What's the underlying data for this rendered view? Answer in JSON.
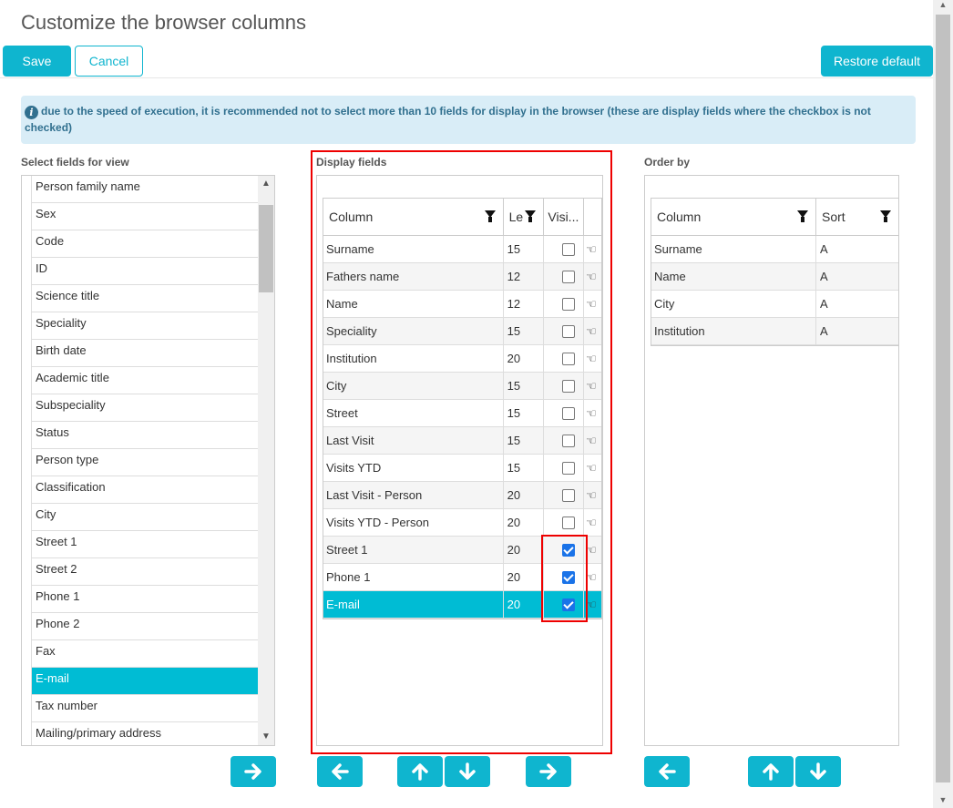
{
  "title": "Customize the browser columns",
  "toolbar": {
    "save": "Save",
    "cancel": "Cancel",
    "restore": "Restore default"
  },
  "info": {
    "icon": "info-icon",
    "text": "due to the speed of execution, it is recommended not to select more than 10 fields for display in the browser (these are display fields where the checkbox is not checked)"
  },
  "left": {
    "label": "Select fields for view",
    "items": [
      "Person family name",
      "Sex",
      "Code",
      "ID",
      "Science title",
      "Speciality",
      "Birth date",
      "Academic title",
      "Subspeciality",
      "Status",
      "Person type",
      "Classification",
      "City",
      "Street 1",
      "Street 2",
      "Phone 1",
      "Phone 2",
      "Fax",
      "E-mail",
      "Tax number",
      "Mailing/primary address"
    ],
    "selected": "E-mail"
  },
  "display": {
    "label": "Display fields",
    "headers": {
      "column": "Column",
      "length": "Le",
      "visible": "Visi..."
    },
    "rows": [
      {
        "column": "Surname",
        "length": "15",
        "visible": false
      },
      {
        "column": "Fathers name",
        "length": "12",
        "visible": false
      },
      {
        "column": "Name",
        "length": "12",
        "visible": false
      },
      {
        "column": "Speciality",
        "length": "15",
        "visible": false
      },
      {
        "column": "Institution",
        "length": "20",
        "visible": false
      },
      {
        "column": "City",
        "length": "15",
        "visible": false
      },
      {
        "column": "Street",
        "length": "15",
        "visible": false
      },
      {
        "column": "Last Visit",
        "length": "15",
        "visible": false
      },
      {
        "column": "Visits YTD",
        "length": "15",
        "visible": false
      },
      {
        "column": "Last Visit - Person",
        "length": "20",
        "visible": false
      },
      {
        "column": "Visits YTD - Person",
        "length": "20",
        "visible": false
      },
      {
        "column": "Street 1",
        "length": "20",
        "visible": true
      },
      {
        "column": "Phone 1",
        "length": "20",
        "visible": true
      },
      {
        "column": "E-mail",
        "length": "20",
        "visible": true,
        "selected": true
      }
    ]
  },
  "order": {
    "label": "Order by",
    "headers": {
      "column": "Column",
      "sort": "Sort"
    },
    "rows": [
      {
        "column": "Surname",
        "sort": "A"
      },
      {
        "column": "Name",
        "sort": "A"
      },
      {
        "column": "City",
        "sort": "A"
      },
      {
        "column": "Institution",
        "sort": "A"
      }
    ]
  },
  "colors": {
    "accent": "#0fb5cf",
    "selection": "#00bcd4",
    "highlight": "#e00000"
  }
}
